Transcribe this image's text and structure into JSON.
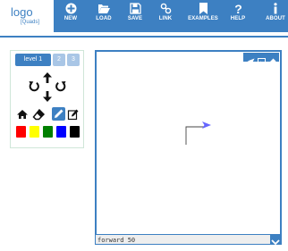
{
  "logo": {
    "word": "logo",
    "subtitle": "[Quads]"
  },
  "nav": [
    {
      "label": "NEW",
      "icon": "plus-circle-icon"
    },
    {
      "label": "LOAD",
      "icon": "folder-open-icon"
    },
    {
      "label": "SAVE",
      "icon": "floppy-disk-icon"
    },
    {
      "label": "LINK",
      "icon": "link-icon"
    },
    {
      "label": "EXAMPLES",
      "icon": "bookmark-icon"
    },
    {
      "label": "HELP",
      "icon": "question-icon"
    },
    {
      "label": "ABOUT",
      "icon": "info-icon"
    }
  ],
  "controls": {
    "levels": [
      "level 1",
      "2",
      "3"
    ],
    "active_level": "level 1",
    "colors": [
      "#ff0000",
      "#ffff00",
      "#008000",
      "#0000ff",
      "#000000"
    ]
  },
  "canvas": {
    "tools": [
      "arrow-icon",
      "image-icon",
      "eraser-icon"
    ]
  },
  "command": {
    "value": "forward 50"
  },
  "theme": {
    "accent": "#3d80c2",
    "turtle": "#6666ff"
  }
}
